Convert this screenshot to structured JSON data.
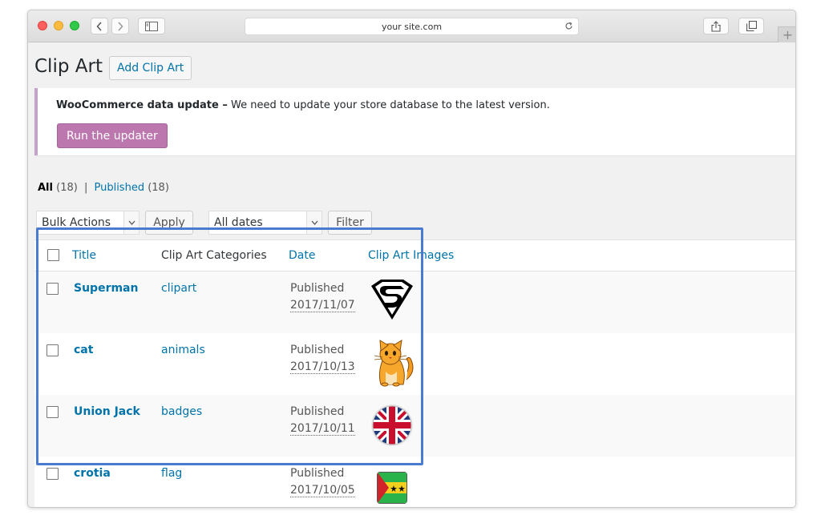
{
  "browser": {
    "url": "your site.com",
    "icons": {
      "back": "chevron-left-icon",
      "forward": "chevron-right-icon",
      "sidebar": "sidebar-icon",
      "reload": "reload-icon",
      "share": "share-icon",
      "tabs": "tabs-icon",
      "new_tab": "+"
    }
  },
  "header": {
    "title": "Clip Art",
    "add_button": "Add Clip Art"
  },
  "notice": {
    "strong": "WooCommerce data update –",
    "message": " We need to update your store database to the latest version.",
    "button": "Run the updater",
    "accent": "#bb77ae"
  },
  "filters": {
    "all_label": "All",
    "all_count": "(18)",
    "separator": "|",
    "published_label": "Published",
    "published_count": "(18)",
    "bulk_actions": "Bulk Actions",
    "apply": "Apply",
    "dates": "All dates",
    "filter": "Filter"
  },
  "table": {
    "columns": [
      "Title",
      "Clip Art Categories",
      "Date",
      "Clip Art Images"
    ],
    "rows": [
      {
        "title": "Superman",
        "category": "clipart",
        "status": "Published",
        "date": "2017/11/07",
        "image": "superman-logo-icon"
      },
      {
        "title": "cat",
        "category": "animals",
        "status": "Published",
        "date": "2017/10/13",
        "image": "cat-icon"
      },
      {
        "title": "Union Jack",
        "category": "badges",
        "status": "Published",
        "date": "2017/10/11",
        "image": "union-jack-badge-icon"
      },
      {
        "title": "crotia",
        "category": "flag",
        "status": "Published",
        "date": "2017/10/05",
        "image": "flag-icon"
      }
    ]
  },
  "colors": {
    "link": "#0073aa",
    "highlight": "#4a7bd0"
  }
}
